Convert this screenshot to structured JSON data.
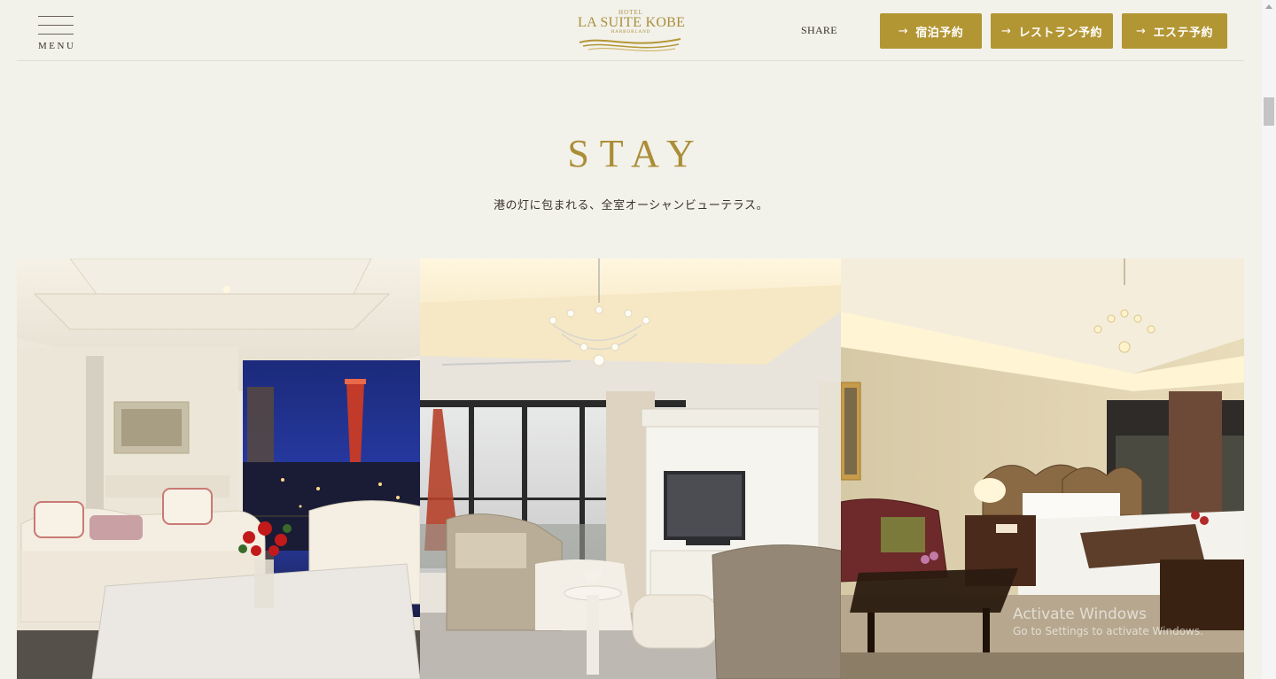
{
  "header": {
    "menu_label": "MENU",
    "logo": {
      "hotel": "HOTEL",
      "name": "LA SUITE KOBE",
      "sub": "HARBORLAND"
    },
    "share_label": "SHARE",
    "buttons": [
      {
        "label": "宿泊予約"
      },
      {
        "label": "レストラン予約"
      },
      {
        "label": "エステ予約"
      }
    ],
    "accent_color": "#b39634"
  },
  "section": {
    "title": "STAY",
    "subtitle": "港の灯に包まれる、全室オーシャンビューテラス。"
  },
  "photos": [
    {
      "name": "living-room-night-photo"
    },
    {
      "name": "living-room-chandelier-photo"
    },
    {
      "name": "bedroom-photo"
    }
  ],
  "watermark": {
    "line1": "Activate Windows",
    "line2": "Go to Settings to activate Windows."
  }
}
